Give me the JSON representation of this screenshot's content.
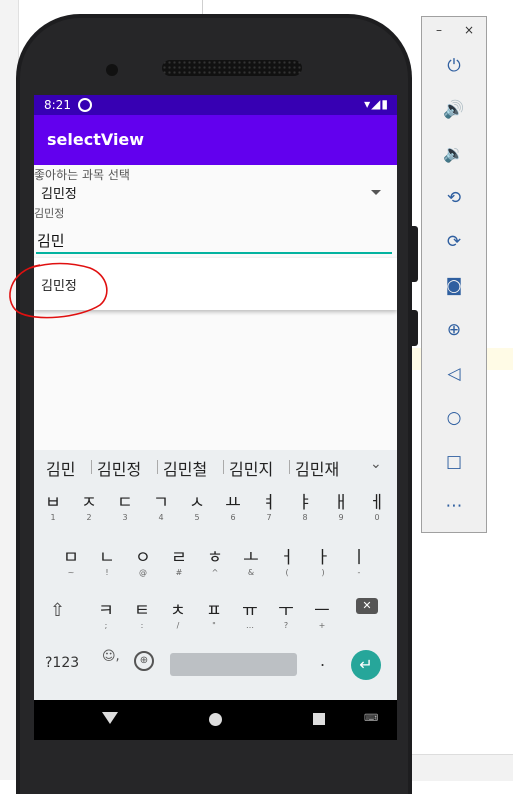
{
  "status_bar": {
    "time": "8:21",
    "right_icons": "▾◢▮"
  },
  "app_bar": {
    "title": "selectView"
  },
  "form": {
    "spinner_label": "좋아하는 과목 선택",
    "spinner_value": "김민정",
    "field_label": "김민정",
    "input_value": "김민",
    "dropdown_items": [
      "김민정"
    ]
  },
  "keyboard": {
    "suggestions": [
      "김민",
      "김민정",
      "김민철",
      "김민지",
      "김민재"
    ],
    "row1": [
      {
        "k": "ㅂ",
        "s": "1"
      },
      {
        "k": "ㅈ",
        "s": "2"
      },
      {
        "k": "ㄷ",
        "s": "3"
      },
      {
        "k": "ㄱ",
        "s": "4"
      },
      {
        "k": "ㅅ",
        "s": "5"
      },
      {
        "k": "ㅛ",
        "s": "6"
      },
      {
        "k": "ㅕ",
        "s": "7"
      },
      {
        "k": "ㅑ",
        "s": "8"
      },
      {
        "k": "ㅐ",
        "s": "9"
      },
      {
        "k": "ㅔ",
        "s": "0"
      }
    ],
    "row2": [
      {
        "k": "ㅁ",
        "s": "~"
      },
      {
        "k": "ㄴ",
        "s": "!"
      },
      {
        "k": "ㅇ",
        "s": "@"
      },
      {
        "k": "ㄹ",
        "s": "#"
      },
      {
        "k": "ㅎ",
        "s": "^"
      },
      {
        "k": "ㅗ",
        "s": "&"
      },
      {
        "k": "ㅓ",
        "s": "("
      },
      {
        "k": "ㅏ",
        "s": ")"
      },
      {
        "k": "ㅣ",
        "s": "-"
      }
    ],
    "row3": [
      {
        "k": "ㅋ",
        "s": ";"
      },
      {
        "k": "ㅌ",
        "s": ":"
      },
      {
        "k": "ㅊ",
        "s": "/"
      },
      {
        "k": "ㅍ",
        "s": "\""
      },
      {
        "k": "ㅠ",
        "s": "…"
      },
      {
        "k": "ㅜ",
        "s": "?"
      },
      {
        "k": "ㅡ",
        "s": "+"
      }
    ],
    "symbols_key": "?123",
    "emoji_key": "☺,",
    "period_key": "."
  },
  "toolbar": {
    "minimize": "–",
    "close": "×",
    "icons": [
      "power-icon",
      "volume-up-icon",
      "volume-down-icon",
      "rotate-left-icon",
      "rotate-right-icon",
      "camera-icon",
      "zoom-icon",
      "back-icon",
      "home-icon",
      "overview-icon",
      "more-icon"
    ]
  },
  "colors": {
    "status_bar": "#3700b3",
    "app_bar": "#6200ee",
    "accent": "#03b3a0",
    "enter": "#26a69a"
  }
}
